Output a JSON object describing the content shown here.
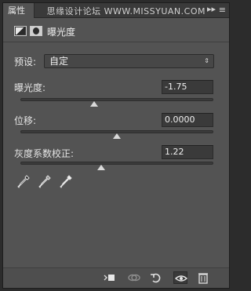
{
  "tabs": {
    "active_label": "属性",
    "menu_glyph": "≡",
    "collapse_glyph": "▸▸"
  },
  "watermark": "思缘设计论坛  WWW.MISSYUAN.COM",
  "header": {
    "title": "曝光度"
  },
  "preset": {
    "label": "预设:",
    "value": "自定"
  },
  "sliders": [
    {
      "label": "曝光度:",
      "value": "-1.75",
      "level": 0.38
    },
    {
      "label": "位移:",
      "value": "0.0000",
      "level": 0.5
    },
    {
      "label": "灰度系数校正:",
      "value": "1.22",
      "level": 0.42
    }
  ],
  "eyedroppers": [
    "black-point-eyedropper-icon",
    "gray-point-eyedropper-icon",
    "white-point-eyedropper-icon"
  ],
  "footer_buttons": [
    "clip-to-layer-icon",
    "view-previous-state-icon",
    "reset-icon",
    "visibility-eye-icon",
    "delete-trash-icon"
  ]
}
